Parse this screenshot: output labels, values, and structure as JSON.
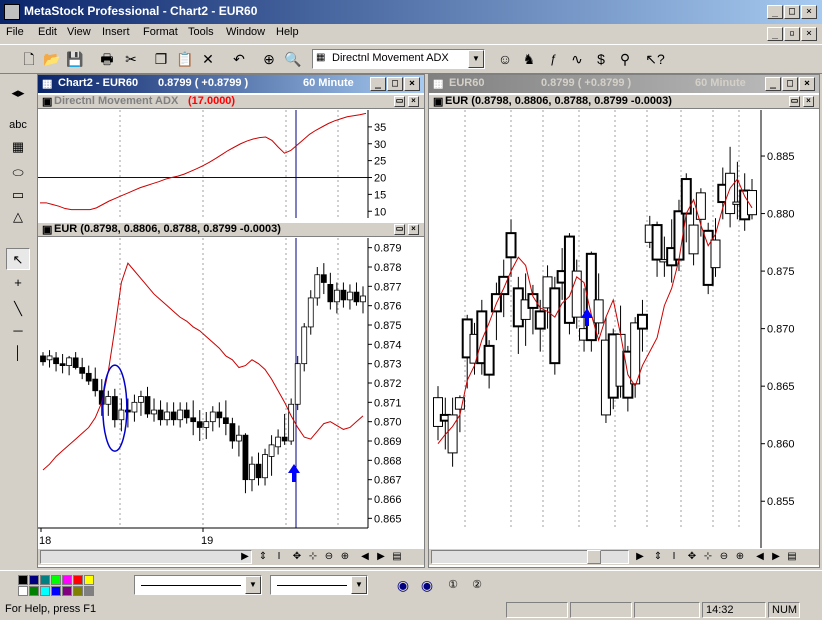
{
  "app": {
    "title": "MetaStock Professional - Chart2 - EUR60",
    "menu": [
      "File",
      "Edit",
      "View",
      "Insert",
      "Format",
      "Tools",
      "Window",
      "Help"
    ],
    "toolbar": {
      "indicator_select": "Directnl Movement ADX"
    },
    "status": {
      "help": "For Help, press F1",
      "time": "14:32",
      "num": "NUM"
    }
  },
  "left_window": {
    "title": "Chart2 - EUR60",
    "quote": "0.8799 ( +0.8799 )",
    "interval": "60 Minute",
    "indicator_panel": {
      "label": "Directnl Movement ADX",
      "value": "(17.0000)",
      "y_ticks": [
        "35",
        "30",
        "25",
        "20",
        "15",
        "10"
      ]
    },
    "price_panel": {
      "label": "EUR (0.8798, 0.8806, 0.8788, 0.8799 -0.0003)",
      "y_ticks": [
        "0.879",
        "0.878",
        "0.877",
        "0.876",
        "0.875",
        "0.874",
        "0.873",
        "0.872",
        "0.871",
        "0.870",
        "0.869",
        "0.868",
        "0.867",
        "0.866",
        "0.865"
      ],
      "x_ticks": [
        "18",
        "19"
      ]
    }
  },
  "right_window": {
    "title": "EUR60",
    "quote": "0.8799 ( +0.8799 )",
    "interval": "60 Minute",
    "price_panel": {
      "label": "EUR (0.8798, 0.8806, 0.8788, 0.8799 -0.0003)",
      "y_ticks": [
        "0.885",
        "0.880",
        "0.875",
        "0.870",
        "0.865",
        "0.860",
        "0.855"
      ]
    }
  },
  "colors": {
    "title_active": "#0a246a",
    "title_inactive": "#808080",
    "ma_line": "#cc0000",
    "adx_line": "#cc0000",
    "crosshair": "#000080",
    "signal_arrow": "#0000ff"
  },
  "palette": [
    "#000000",
    "#000080",
    "#008080",
    "#00ff00",
    "#ff00ff",
    "#ff0000",
    "#ffff00",
    "#ffffff",
    "#008000",
    "#00ffff",
    "#0000ff",
    "#800080",
    "#808000",
    "#808080"
  ],
  "chart_data": [
    {
      "type": "line",
      "title": "Directnl Movement ADX",
      "ylim": [
        8,
        40
      ],
      "series": [
        {
          "name": "ADX",
          "values": [
            12.5,
            12.5,
            12,
            11.5,
            10.8,
            10.5,
            10.5,
            10.5,
            10.5,
            11,
            12,
            13,
            13.8,
            14.6,
            15.4,
            16.2,
            17,
            17.6,
            18.2,
            18.8,
            19.5,
            20,
            20.4,
            21,
            21.8,
            22.6,
            23.5,
            24.5,
            25.6,
            26.8,
            28,
            29,
            30,
            30.8,
            31.4,
            31.8,
            32,
            31,
            29,
            27.2,
            28,
            29.6,
            31.2,
            32.8,
            34,
            35,
            36,
            36.8,
            37.4,
            38,
            38.3,
            38.6,
            39
          ]
        }
      ]
    },
    {
      "type": "candlestick",
      "title": "EUR",
      "ylim": [
        0.8645,
        0.8795
      ],
      "candles": [
        [
          0.8734,
          0.8736,
          0.8729,
          0.8731
        ],
        [
          0.8732,
          0.8737,
          0.8728,
          0.8734
        ],
        [
          0.8733,
          0.8736,
          0.8726,
          0.873
        ],
        [
          0.873,
          0.8735,
          0.8725,
          0.8729
        ],
        [
          0.8729,
          0.8734,
          0.8724,
          0.8733
        ],
        [
          0.8733,
          0.8736,
          0.8727,
          0.8728
        ],
        [
          0.8728,
          0.8733,
          0.8722,
          0.8725
        ],
        [
          0.8725,
          0.8729,
          0.8719,
          0.8721
        ],
        [
          0.8722,
          0.8728,
          0.8713,
          0.8716
        ],
        [
          0.8716,
          0.8722,
          0.8703,
          0.8709
        ],
        [
          0.8709,
          0.8716,
          0.8703,
          0.8713
        ],
        [
          0.8713,
          0.8717,
          0.8697,
          0.8701
        ],
        [
          0.8701,
          0.8712,
          0.8695,
          0.8706
        ],
        [
          0.8706,
          0.8712,
          0.8697,
          0.8705
        ],
        [
          0.8705,
          0.8714,
          0.87,
          0.871
        ],
        [
          0.871,
          0.8716,
          0.8703,
          0.8713
        ],
        [
          0.8713,
          0.8718,
          0.8702,
          0.8704
        ],
        [
          0.8704,
          0.8712,
          0.87,
          0.8706
        ],
        [
          0.8706,
          0.8711,
          0.8698,
          0.8701
        ],
        [
          0.8701,
          0.871,
          0.8698,
          0.8705
        ],
        [
          0.8705,
          0.871,
          0.8698,
          0.8701
        ],
        [
          0.8701,
          0.871,
          0.8697,
          0.8706
        ],
        [
          0.8706,
          0.871,
          0.8699,
          0.8702
        ],
        [
          0.8702,
          0.8711,
          0.8693,
          0.87
        ],
        [
          0.87,
          0.8706,
          0.869,
          0.8697
        ],
        [
          0.8697,
          0.8705,
          0.8691,
          0.87
        ],
        [
          0.87,
          0.8708,
          0.8695,
          0.8705
        ],
        [
          0.8705,
          0.871,
          0.8697,
          0.8702
        ],
        [
          0.8702,
          0.8711,
          0.8693,
          0.8699
        ],
        [
          0.8699,
          0.8702,
          0.8686,
          0.869
        ],
        [
          0.869,
          0.8698,
          0.8682,
          0.8693
        ],
        [
          0.8693,
          0.8694,
          0.8663,
          0.867
        ],
        [
          0.867,
          0.8682,
          0.8664,
          0.8678
        ],
        [
          0.8678,
          0.8684,
          0.8667,
          0.8671
        ],
        [
          0.8671,
          0.8686,
          0.8667,
          0.8683
        ],
        [
          0.8682,
          0.8693,
          0.8672,
          0.8688
        ],
        [
          0.8687,
          0.8696,
          0.8683,
          0.8692
        ],
        [
          0.8692,
          0.8704,
          0.8688,
          0.869
        ],
        [
          0.869,
          0.8712,
          0.8688,
          0.8709
        ],
        [
          0.8709,
          0.8734,
          0.8706,
          0.873
        ],
        [
          0.873,
          0.8751,
          0.8726,
          0.8749
        ],
        [
          0.8749,
          0.8768,
          0.8745,
          0.8764
        ],
        [
          0.8764,
          0.878,
          0.876,
          0.8776
        ],
        [
          0.8776,
          0.8782,
          0.8766,
          0.8772
        ],
        [
          0.8771,
          0.8777,
          0.8758,
          0.8762
        ],
        [
          0.8762,
          0.8772,
          0.8756,
          0.8768
        ],
        [
          0.8768,
          0.8772,
          0.8759,
          0.8763
        ],
        [
          0.8763,
          0.8771,
          0.8758,
          0.8767
        ],
        [
          0.8767,
          0.8772,
          0.876,
          0.8762
        ],
        [
          0.8762,
          0.877,
          0.8756,
          0.8765
        ]
      ],
      "series": [
        {
          "name": "MA",
          "values": [
            0.8675,
            0.8678,
            0.8682,
            0.8685,
            0.8688,
            0.8691,
            0.8694,
            0.8697,
            0.8702,
            0.871,
            0.8726,
            0.8748,
            0.8772,
            0.8782,
            0.8778,
            0.8774,
            0.877,
            0.8766,
            0.8763,
            0.876,
            0.8757,
            0.8754,
            0.8752,
            0.8749,
            0.8747,
            0.8744,
            0.8741,
            0.8738,
            0.8734,
            0.8732,
            0.8728,
            0.8729,
            0.8732,
            0.873,
            0.8727,
            0.8722,
            0.8716,
            0.871,
            0.8703,
            0.8697,
            0.8692,
            0.8691,
            0.8695,
            0.8699,
            0.87,
            0.8698,
            0.8696,
            0.8697,
            0.87,
            0.8703
          ]
        }
      ]
    },
    {
      "type": "candlestick",
      "title": "EUR",
      "ylim": [
        0.8525,
        0.889
      ],
      "candles": [
        [
          0.864,
          0.865,
          0.8603,
          0.8615
        ],
        [
          0.862,
          0.864,
          0.8595,
          0.8625
        ],
        [
          0.8625,
          0.864,
          0.858,
          0.8592
        ],
        [
          0.864,
          0.8642,
          0.861,
          0.863
        ],
        [
          0.8675,
          0.8712,
          0.8648,
          0.8708
        ],
        [
          0.8695,
          0.8705,
          0.866,
          0.867
        ],
        [
          0.867,
          0.8725,
          0.866,
          0.8715
        ],
        [
          0.866,
          0.869,
          0.8648,
          0.8685
        ],
        [
          0.8715,
          0.874,
          0.869,
          0.873
        ],
        [
          0.873,
          0.876,
          0.871,
          0.8745
        ],
        [
          0.8762,
          0.8795,
          0.8745,
          0.8783
        ],
        [
          0.8702,
          0.8745,
          0.8678,
          0.8735
        ],
        [
          0.8725,
          0.8748,
          0.8685,
          0.8708
        ],
        [
          0.8718,
          0.8738,
          0.8695,
          0.873
        ],
        [
          0.87,
          0.8725,
          0.868,
          0.8715
        ],
        [
          0.8745,
          0.8755,
          0.87,
          0.8718
        ],
        [
          0.867,
          0.8745,
          0.866,
          0.8735
        ],
        [
          0.874,
          0.877,
          0.8725,
          0.875
        ],
        [
          0.8705,
          0.8783,
          0.8695,
          0.878
        ],
        [
          0.875,
          0.876,
          0.87,
          0.871
        ],
        [
          0.87,
          0.8735,
          0.868,
          0.869
        ],
        [
          0.869,
          0.8767,
          0.868,
          0.8765
        ],
        [
          0.8725,
          0.8748,
          0.8695,
          0.8705
        ],
        [
          0.869,
          0.871,
          0.8618,
          0.8625
        ],
        [
          0.864,
          0.87,
          0.863,
          0.8695
        ],
        [
          0.8695,
          0.872,
          0.864,
          0.865
        ],
        [
          0.864,
          0.8685,
          0.8628,
          0.868
        ],
        [
          0.8705,
          0.871,
          0.864,
          0.8652
        ],
        [
          0.87,
          0.8725,
          0.868,
          0.8712
        ],
        [
          0.879,
          0.8798,
          0.877,
          0.8775
        ],
        [
          0.876,
          0.8793,
          0.8745,
          0.879
        ],
        [
          0.876,
          0.878,
          0.8745,
          0.8758
        ],
        [
          0.8755,
          0.8795,
          0.874,
          0.877
        ],
        [
          0.876,
          0.8812,
          0.875,
          0.8802
        ],
        [
          0.88,
          0.8835,
          0.8775,
          0.883
        ],
        [
          0.879,
          0.8805,
          0.8755,
          0.8765
        ],
        [
          0.8818,
          0.8822,
          0.878,
          0.8795
        ],
        [
          0.8738,
          0.8792,
          0.873,
          0.8785
        ],
        [
          0.8777,
          0.8796,
          0.8745,
          0.8753
        ],
        [
          0.881,
          0.884,
          0.8795,
          0.8825
        ],
        [
          0.8835,
          0.8858,
          0.8788,
          0.88
        ],
        [
          0.881,
          0.8845,
          0.8795,
          0.8808
        ],
        [
          0.8795,
          0.8835,
          0.8785,
          0.882
        ],
        [
          0.882,
          0.883,
          0.8795,
          0.8799
        ]
      ],
      "series": [
        {
          "name": "MA",
          "values": [
            0.86,
            0.8608,
            0.8615,
            0.8625,
            0.8655,
            0.8668,
            0.869,
            0.8705,
            0.8722,
            0.8735,
            0.875,
            0.8762,
            0.8755,
            0.8728,
            0.8718,
            0.8715,
            0.871,
            0.8722,
            0.8728,
            0.8745,
            0.874,
            0.8712,
            0.869,
            0.871,
            0.8725,
            0.8695,
            0.866,
            0.865,
            0.8668,
            0.868,
            0.8692,
            0.872,
            0.8735,
            0.876,
            0.88,
            0.8812,
            0.879,
            0.8772,
            0.8782,
            0.8805,
            0.8822,
            0.883,
            0.8815,
            0.8805
          ]
        }
      ]
    }
  ]
}
